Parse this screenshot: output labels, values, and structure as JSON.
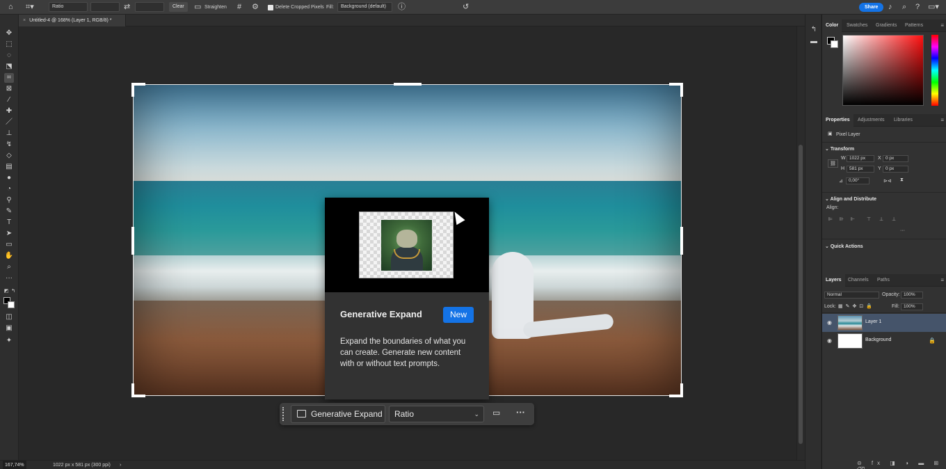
{
  "topbar": {
    "ratio_label": "Ratio",
    "clear_label": "Clear",
    "straighten_label": "Straighten",
    "delete_cropped_label": "Delete Cropped Pixels",
    "fill_label": "Fill:",
    "fill_value": "Background (default)",
    "share_label": "Share"
  },
  "document": {
    "tab_title": "Untitled-4 @ 168% (Layer 1, RGB/8) *"
  },
  "popup": {
    "title": "Generative Expand",
    "badge": "New",
    "description": "Expand the boundaries of what you can create. Generate new content with or without text prompts."
  },
  "taskbar": {
    "expand_label": "Generative Expand",
    "ratio_value": "Ratio"
  },
  "status": {
    "zoom": "167,74%",
    "dimensions": "1022 px x 581 px (300 ppi)",
    "arrow": "›"
  },
  "color_panel": {
    "tabs": [
      "Color",
      "Swatches",
      "Gradients",
      "Patterns"
    ]
  },
  "properties_panel": {
    "tabs": [
      "Properties",
      "Adjustments",
      "Libraries"
    ],
    "type_label": "Pixel Layer",
    "transform_heading": "Transform",
    "w_label": "W",
    "w_value": "1022 px",
    "h_label": "H",
    "h_value": "581 px",
    "x_label": "X",
    "x_value": "0 px",
    "y_label": "Y",
    "y_value": "0 px",
    "angle_value": "0,00°",
    "align_heading": "Align and Distribute",
    "align_label": "Align:",
    "quick_actions_heading": "Quick Actions"
  },
  "layers_panel": {
    "tabs": [
      "Layers",
      "Channels",
      "Paths"
    ],
    "blend_mode": "Normal",
    "opacity_label": "Opacity:",
    "opacity_value": "100%",
    "lock_label": "Lock:",
    "fill_label": "Fill:",
    "fill_value": "100%",
    "layers": [
      {
        "name": "Layer 1"
      },
      {
        "name": "Background"
      }
    ]
  },
  "colors": {
    "accent": "#1473e6",
    "selected_layer": "#45546a"
  }
}
